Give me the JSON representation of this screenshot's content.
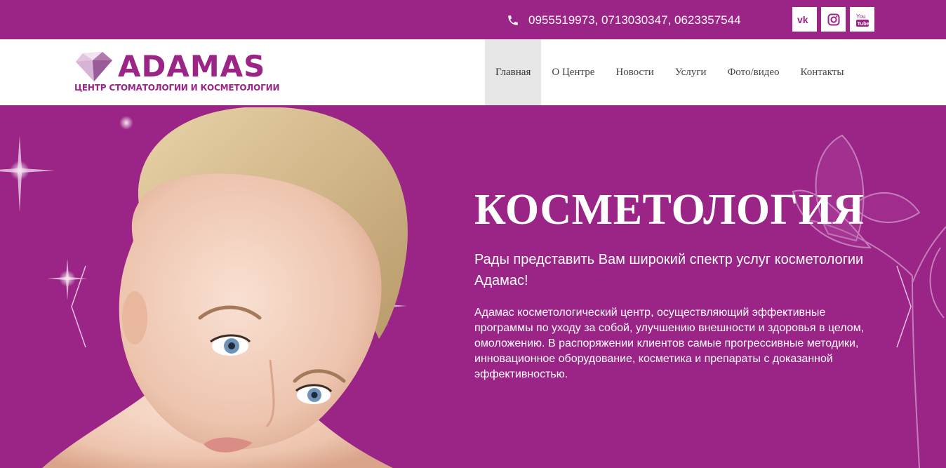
{
  "topbar": {
    "phones": "0955519973, 0713030347, 0623357544",
    "phone_icon": "phone-icon",
    "socials": [
      {
        "name": "vk-icon",
        "label": "VK"
      },
      {
        "name": "instagram-icon",
        "label": "Instagram"
      },
      {
        "name": "youtube-icon",
        "label": "YouTube"
      }
    ]
  },
  "logo": {
    "word": "ADAMAS",
    "subtitle": "ЦЕНТР СТОМАТОЛОГИИ И КОСМЕТОЛОГИИ"
  },
  "nav": {
    "items": [
      {
        "label": "Главная",
        "active": true
      },
      {
        "label": "О Центре"
      },
      {
        "label": "Новости"
      },
      {
        "label": "Услуги"
      },
      {
        "label": "Фото/видео"
      },
      {
        "label": "Контакты"
      }
    ]
  },
  "hero": {
    "title": "КОСМЕТОЛОГИЯ",
    "subtitle": "Рады представить Вам широкий спектр услуг косметологии Адамас!",
    "text": "Адамас косметологический центр, осуществляющий эффективные программы по уходу за собой, улучшению внешности и здоровья в целом, омоложению. В распоряжении клиентов самые прогрессивные методики, инновационное оборудование, косметика и препараты с доказанной эффективностью."
  },
  "colors": {
    "brand": "#9b2487",
    "nav_active_bg": "#e6e6e6",
    "white": "#ffffff"
  }
}
